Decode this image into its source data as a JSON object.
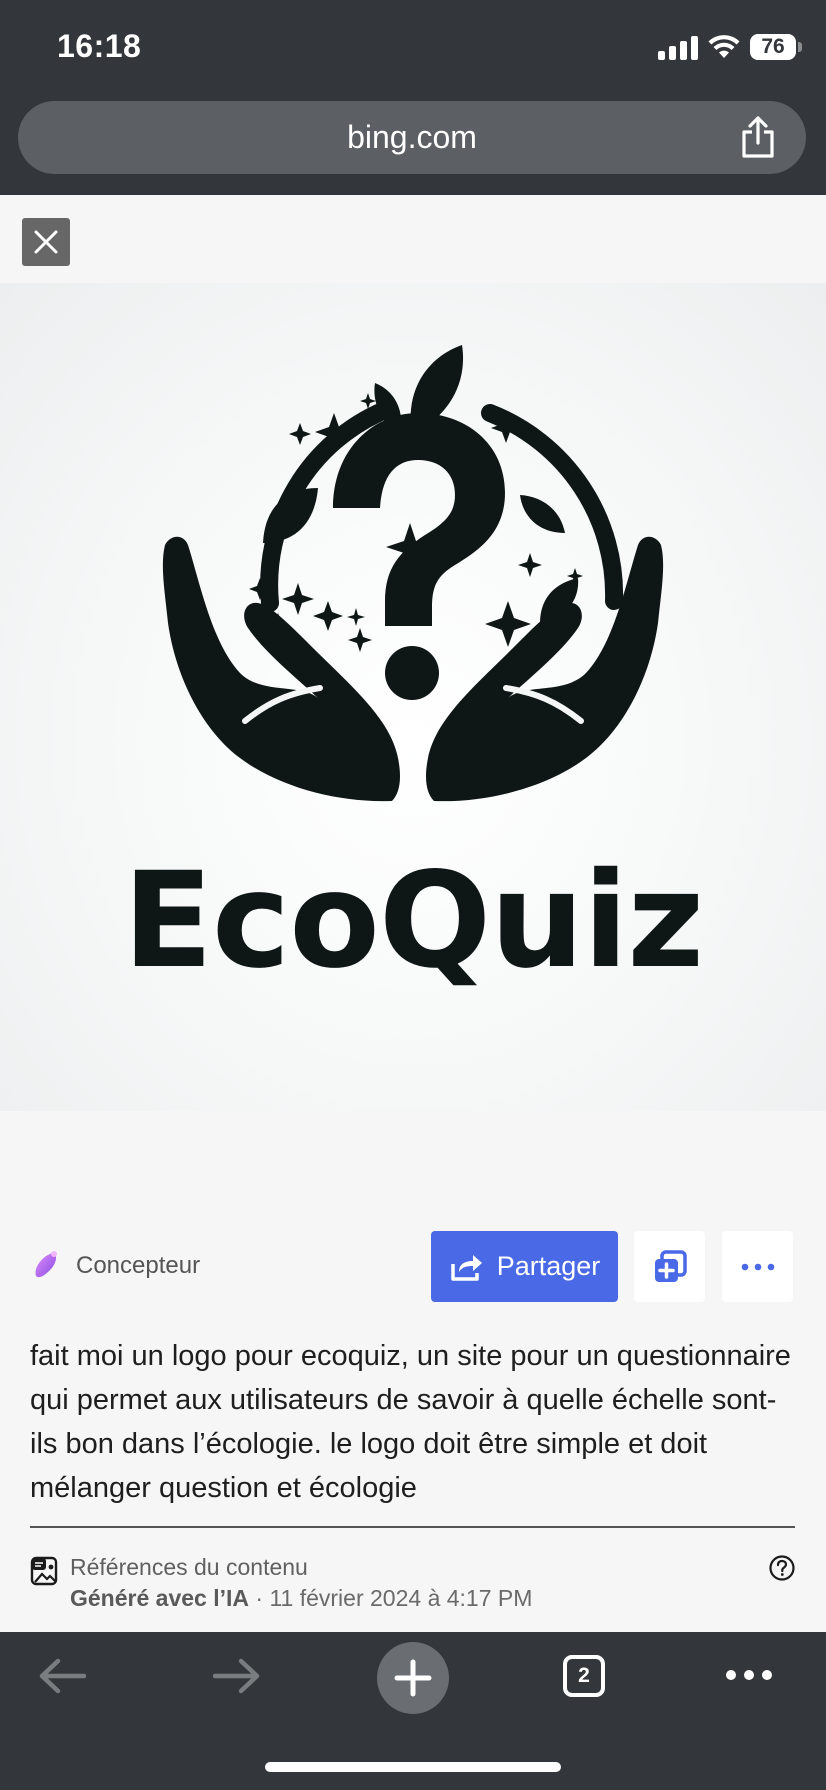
{
  "status_bar": {
    "time": "16:18",
    "battery": "76",
    "icons": [
      "cellular-signal-icon",
      "wifi-icon",
      "battery-icon"
    ]
  },
  "browser": {
    "url": "bing.com",
    "share_icon": "share-icon"
  },
  "viewer": {
    "close_icon": "close-icon",
    "image": {
      "logo_text": "EcoQuiz",
      "description_icons": [
        "question-mark",
        "leaves",
        "stars",
        "hands"
      ]
    }
  },
  "actions": {
    "designer_label": "Concepteur",
    "share_label": "Partager",
    "add_to_collection_icon": "add-collection-icon",
    "more_icon": "more-icon",
    "accent_color": "#4a69e6"
  },
  "prompt": {
    "text": "fait moi un logo pour ecoquiz, un site pour un questionnaire qui permet aux utilisateurs de savoir à quelle échelle sont-ils bon dans l’écologie. le logo doit être simple et doit mélanger question et écologie"
  },
  "references": {
    "title": "Références du contenu",
    "generated": "Généré avec l’IA",
    "separator": " · ",
    "date": "11 février 2024 à 4:17 PM"
  },
  "toolbar": {
    "tab_count": "2",
    "icons": [
      "back-arrow-icon",
      "forward-arrow-icon",
      "plus-icon",
      "tabs-icon",
      "more-icon"
    ]
  }
}
